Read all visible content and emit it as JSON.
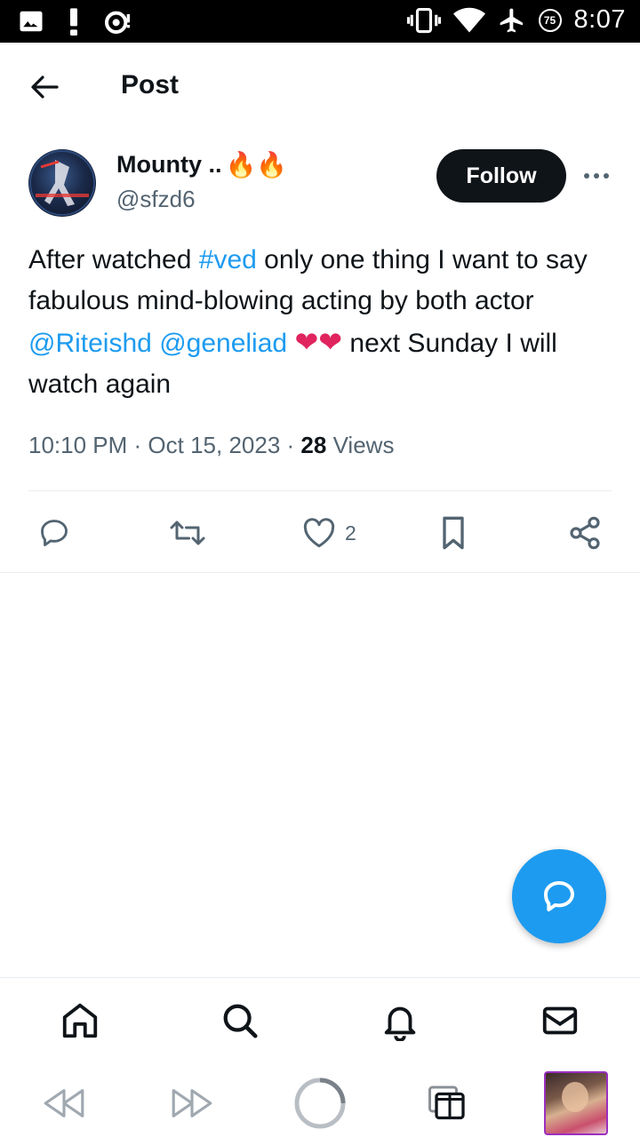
{
  "status_bar": {
    "time": "8:07",
    "battery_level": "75",
    "icons": [
      "image-icon",
      "alert-icon",
      "sync-icon",
      "vibrate-icon",
      "wifi-icon",
      "airplane-icon",
      "battery-icon"
    ]
  },
  "header": {
    "title": "Post"
  },
  "author": {
    "name": "Mounty ..",
    "name_emojis": "🔥🔥",
    "handle": "@sfzd6",
    "follow_label": "Follow"
  },
  "tweet": {
    "part1": "After watched ",
    "hashtag": "#ved",
    "part2": " only one thing I want to say fabulous mind-blowing acting by both actor ",
    "mention1": "@Riteishd",
    "mention2": "@geneliad",
    "hearts": "❤❤",
    "part3": " next Sunday I will watch again"
  },
  "meta": {
    "time": "10:10 PM",
    "date": "Oct 15, 2023",
    "views_count": "28",
    "views_label": "Views"
  },
  "actions": {
    "like_count": "2"
  },
  "colors": {
    "accent": "#1d9bf0",
    "text_primary": "#0f1419",
    "text_secondary": "#536471",
    "heart": "#e0245e"
  }
}
